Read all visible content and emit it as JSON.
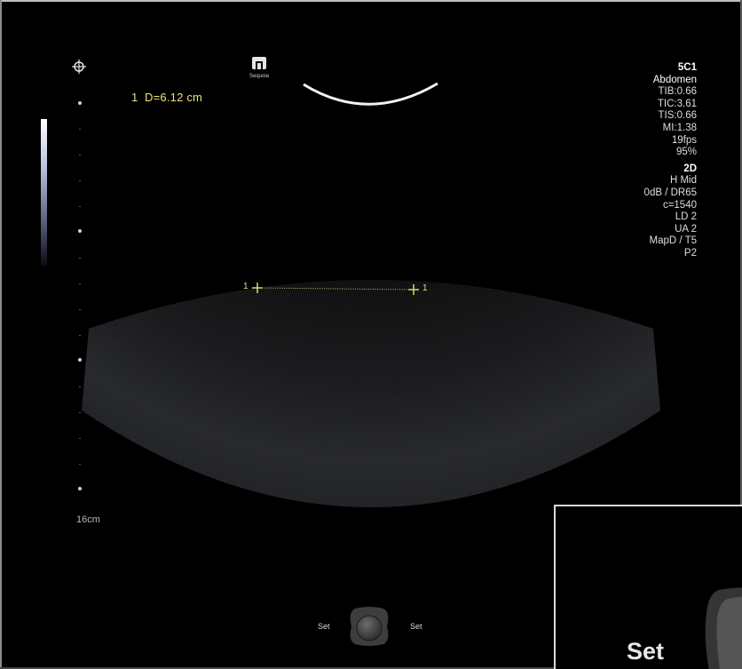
{
  "measurement": {
    "readout": "1  D=6.12 cm",
    "start_marker": "1",
    "end_marker": "1"
  },
  "logo": {
    "text": "Sequoia"
  },
  "depth": {
    "label": "16cm"
  },
  "probe_params": {
    "transducer": "5C1",
    "preset": "Abdomen",
    "tib": "TIB:0.66",
    "tic": "TIC:3.61",
    "tis": "TIS:0.66",
    "mi": "MI:1.38",
    "frame_rate": "19fps",
    "power": "95%"
  },
  "imaging_params": {
    "mode": "2D",
    "frequency": "H Mid",
    "gain_dr": "0dB / DR65",
    "sound_speed": "c=1540",
    "ld": "LD 2",
    "ua": "UA 2",
    "map": "MapD / T5",
    "persistence": "P2"
  },
  "controls": {
    "set_left": "Set",
    "set_right": "Set",
    "zoom_set": "Set"
  },
  "icons": {
    "cursor": "crosshair-icon",
    "trackball": "trackball-icon"
  },
  "colors": {
    "caliper": "#e8e27a",
    "text": "#dedede",
    "background": "#000000"
  }
}
